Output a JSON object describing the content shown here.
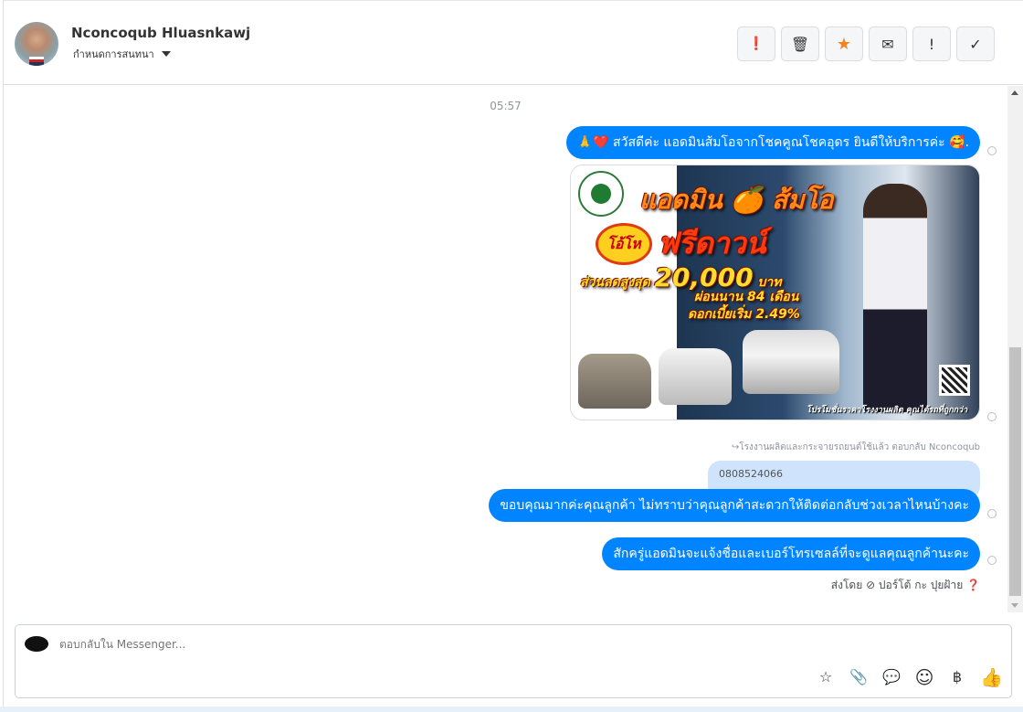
{
  "header": {
    "name": "Nconcoqub Hluasnkawj",
    "subtitle": "กำหนดการสนทนา",
    "tools": [
      {
        "icon": "alert-circle-icon",
        "glyph": "❗"
      },
      {
        "icon": "trash-icon",
        "glyph": "🗑"
      },
      {
        "icon": "star-icon",
        "glyph": "★"
      },
      {
        "icon": "envelope-icon",
        "glyph": "✉"
      },
      {
        "icon": "exclamation-icon",
        "glyph": "!"
      },
      {
        "icon": "check-icon",
        "glyph": "✓"
      }
    ]
  },
  "chat": {
    "timestamp": "05:57",
    "greeting": "🙏❤️ สวัสดีค่ะ แอดมินส้มโอจากโชคคูณโชคอุดร ยินดีให้บริการค่ะ 🥰.",
    "ad": {
      "title1": "แอดมิน 🍊 ส้มโอ",
      "burst": "โอ้โห",
      "title2": "ฟรีดาวน์",
      "discount_label": "ส่วนลดสูงสุด",
      "discount_value": "20,000",
      "currency": "บาท",
      "installment": "ผ่อนนาน 84 เดือน",
      "interest": "ดอกเบี้ยเริ่ม 2.49%",
      "footer": "โปรโมชั่นราคาโรงงานผลิต คุณได้รถที่ถูกกว่า"
    },
    "reply_hint": "↪โรงงานผลิตและกระจายรถยนต์ใช้แล้ว ตอบกลับ Nconcoqub",
    "quoted": "0808524066",
    "message2": "ขอบคุณมากค่ะคุณลูกค้า ไม่ทราบว่าคุณลูกค้าสะดวกให้ติดต่อกลับช่วงเวลาไหนบ้างคะ",
    "message3": "สักครู่แอดมินจะแจ้งชื่อและเบอร์โทรเซลล์ที่จะดูแลคุณลูกค้านะคะ",
    "sent_by": "ส่งโดย ⊘ ปอร์โต้ กะ ปุยฝ้าย ❓"
  },
  "composer": {
    "placeholder": "ตอบกลับใน Messenger...",
    "icons": [
      {
        "icon": "saved-reply-icon",
        "glyph": "☆"
      },
      {
        "icon": "paperclip-icon",
        "glyph": "📎"
      },
      {
        "icon": "chat-bubble-icon",
        "glyph": "💬"
      },
      {
        "icon": "emoji-icon",
        "glyph": "☺"
      },
      {
        "icon": "baht-icon",
        "glyph": "฿"
      },
      {
        "icon": "thumbs-up-icon",
        "glyph": "👍"
      }
    ]
  }
}
